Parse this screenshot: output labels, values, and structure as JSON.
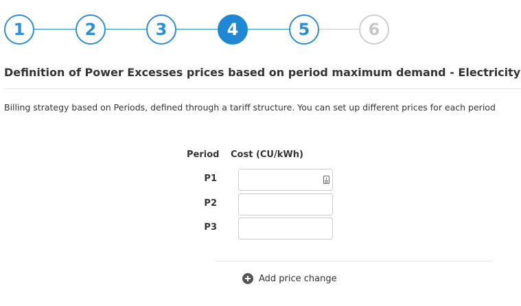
{
  "stepper": {
    "steps": [
      {
        "label": "1",
        "state": "completed"
      },
      {
        "label": "2",
        "state": "completed"
      },
      {
        "label": "3",
        "state": "completed"
      },
      {
        "label": "4",
        "state": "active"
      },
      {
        "label": "5",
        "state": "completed"
      },
      {
        "label": "6",
        "state": "disabled"
      }
    ],
    "colors": {
      "accent": "#1f87d3",
      "disabled": "#c7c7c7"
    }
  },
  "header": {
    "title": "Definition of Power Excesses prices based on period maximum demand - Electricity",
    "description": "Billing strategy based on Periods, defined through a tariff structure. You can set up different prices for each period"
  },
  "table": {
    "period_header": "Period",
    "cost_header": "Cost (CU/kWh)",
    "rows": [
      {
        "period": "P1",
        "value": ""
      },
      {
        "period": "P2",
        "value": ""
      },
      {
        "period": "P3",
        "value": ""
      }
    ],
    "input_icon": "contact-card-icon"
  },
  "actions": {
    "add_label": "Add price change",
    "add_icon": "plus-circle-icon"
  }
}
